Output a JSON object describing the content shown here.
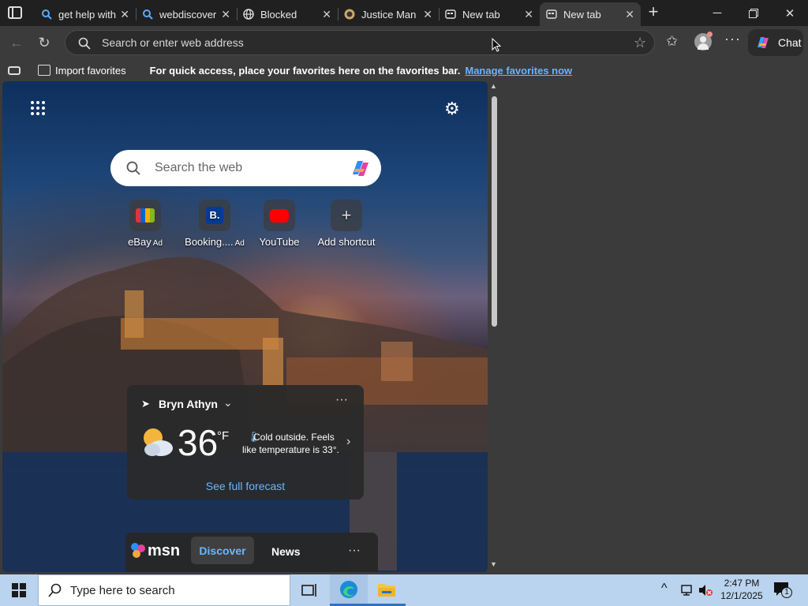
{
  "tabs": [
    {
      "title": "get help with",
      "icon": "bing-search-icon"
    },
    {
      "title": "webdiscover",
      "icon": "bing-search-icon"
    },
    {
      "title": "Blocked",
      "icon": "globe-icon"
    },
    {
      "title": "Justice Man",
      "icon": "site-favicon"
    },
    {
      "title": "New tab",
      "icon": "newtab-icon"
    },
    {
      "title": "New tab",
      "icon": "newtab-icon",
      "active": true
    }
  ],
  "address_bar": {
    "placeholder": "Search or enter web address"
  },
  "chat_button": {
    "label": "Chat"
  },
  "favorites_bar": {
    "import_label": "Import favorites",
    "message": "For quick access, place your favorites here on the favorites bar.",
    "manage_link": "Manage favorites now"
  },
  "newtab": {
    "search_placeholder": "Search the web",
    "shortcuts": [
      {
        "label": "eBay",
        "ad": "Ad",
        "icon": "ebay-icon"
      },
      {
        "label": "Booking....",
        "ad": "Ad",
        "icon": "booking-icon"
      },
      {
        "label": "YouTube",
        "ad": "",
        "icon": "youtube-icon"
      },
      {
        "label": "Add shortcut",
        "ad": "",
        "icon": "plus-icon"
      }
    ],
    "weather": {
      "location": "Bryn Athyn",
      "temperature": "36",
      "unit": "°F",
      "description": "Cold outside. Feels like temperature is 33°.",
      "forecast_link": "See full forecast"
    },
    "feed": {
      "brand": "msn",
      "tabs": [
        "Discover",
        "News"
      ]
    }
  },
  "taskbar": {
    "search_placeholder": "Type here to search",
    "time": "2:47 PM",
    "date": "12/1/2025",
    "notification_count": "1"
  },
  "colors": {
    "accent_link": "#6cb6ff",
    "taskbar": "#bad3ee",
    "browser_bg": "#3b3b3b"
  }
}
